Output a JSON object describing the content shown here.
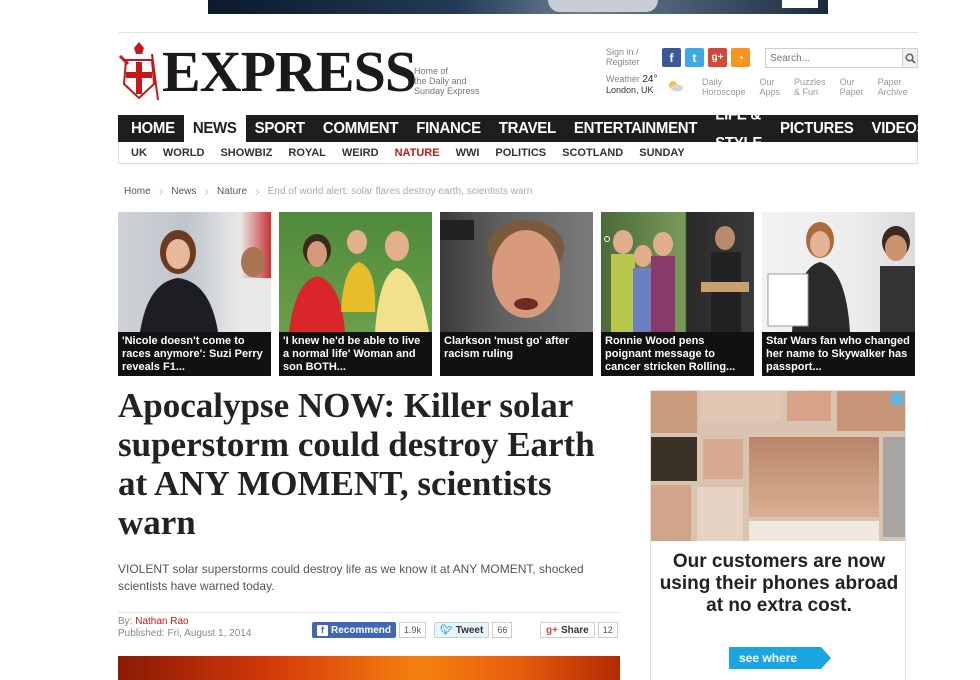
{
  "site": {
    "logo": "EXPRESS",
    "tagline": [
      "Home of",
      "the Daily and",
      "Sunday Express"
    ],
    "sign_in": "Sign in /",
    "register": "Register",
    "search_placeholder": "Search...",
    "weather_label": "Weather",
    "temperature": "24°",
    "city": "London, UK",
    "quick_links": [
      [
        "Daily",
        "Horoscope"
      ],
      [
        "Our",
        "Apps"
      ],
      [
        "Puzzles",
        "& Fun"
      ],
      [
        "Our",
        "Paper"
      ],
      [
        "Paper",
        "Archive"
      ]
    ]
  },
  "nav": [
    "HOME",
    "NEWS",
    "SPORT",
    "COMMENT",
    "FINANCE",
    "TRAVEL",
    "ENTERTAINMENT",
    "LIFE & STYLE",
    "PICTURES",
    "VIDEOS"
  ],
  "nav_active": "NEWS",
  "subnav": [
    "UK",
    "WORLD",
    "SHOWBIZ",
    "ROYAL",
    "WEIRD",
    "NATURE",
    "WWI",
    "POLITICS",
    "SCOTLAND",
    "SUNDAY"
  ],
  "subnav_active": "NATURE",
  "breadcrumb": [
    "Home",
    "News",
    "Nature",
    "End of world alert: solar flares destroy earth, scientists warn"
  ],
  "thumbs": [
    {
      "caption": "'Nicole doesn't come to races anymore': Suzi Perry reveals F1..."
    },
    {
      "caption": "'I knew he'd be able to live a normal life' Woman and son BOTH..."
    },
    {
      "caption": "Clarkson 'must go' after racism ruling"
    },
    {
      "caption": "Ronnie Wood pens poignant message to cancer stricken Rolling..."
    },
    {
      "caption": "Star Wars fan who changed her name to Skywalker has passport..."
    }
  ],
  "article": {
    "headline": "Apocalypse NOW: Killer solar superstorm could destroy Earth at ANY MOMENT, scientists warn",
    "standfirst": "VIOLENT solar superstorms could destroy life as we know it at ANY MOMENT, shocked scientists have warned today.",
    "by_label": "By:",
    "author": "Nathan Rao",
    "published": "Published: Fri, August 1, 2014"
  },
  "share": {
    "recommend": "Recommend",
    "recommend_count": "1.9k",
    "tweet": "Tweet",
    "tweet_count": "66",
    "gplus": "Share",
    "gplus_count": "12"
  },
  "ad": {
    "text": "Our customers are now using their phones abroad at no extra cost.",
    "cta": "see where"
  },
  "colors": {
    "nav_bg": "#1e1e1e",
    "accent_red": "#c21a1a",
    "ad_blue": "#1aa6e0"
  }
}
